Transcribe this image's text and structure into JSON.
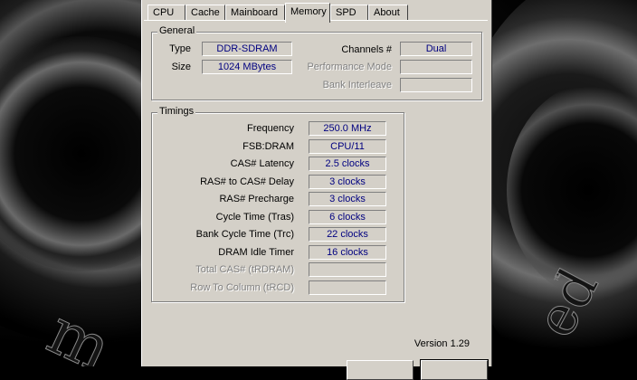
{
  "tabs": [
    "CPU",
    "Cache",
    "Mainboard",
    "Memory",
    "SPD",
    "About"
  ],
  "active_tab": "Memory",
  "general": {
    "title": "General",
    "type_label": "Type",
    "type_value": "DDR-SDRAM",
    "size_label": "Size",
    "size_value": "1024 MBytes",
    "channels_label": "Channels #",
    "channels_value": "Dual",
    "perf_mode_label": "Performance Mode",
    "perf_mode_value": "",
    "bank_interleave_label": "Bank Interleave",
    "bank_interleave_value": ""
  },
  "timings": {
    "title": "Timings",
    "rows": [
      {
        "label": "Frequency",
        "value": "250.0 MHz",
        "enabled": true
      },
      {
        "label": "FSB:DRAM",
        "value": "CPU/11",
        "enabled": true
      },
      {
        "label": "CAS# Latency",
        "value": "2.5 clocks",
        "enabled": true
      },
      {
        "label": "RAS# to CAS# Delay",
        "value": "3 clocks",
        "enabled": true
      },
      {
        "label": "RAS# Precharge",
        "value": "3 clocks",
        "enabled": true
      },
      {
        "label": "Cycle Time (Tras)",
        "value": "6 clocks",
        "enabled": true
      },
      {
        "label": "Bank Cycle Time (Trc)",
        "value": "22 clocks",
        "enabled": true
      },
      {
        "label": "DRAM Idle Timer",
        "value": "16 clocks",
        "enabled": true
      },
      {
        "label": "Total CAS# (tRDRAM)",
        "value": "",
        "enabled": false
      },
      {
        "label": "Row To Column (tRCD)",
        "value": "",
        "enabled": false
      }
    ]
  },
  "version": "Version 1.29",
  "colors": {
    "value_text": "#000080",
    "window_bg": "#d4d0c8"
  }
}
